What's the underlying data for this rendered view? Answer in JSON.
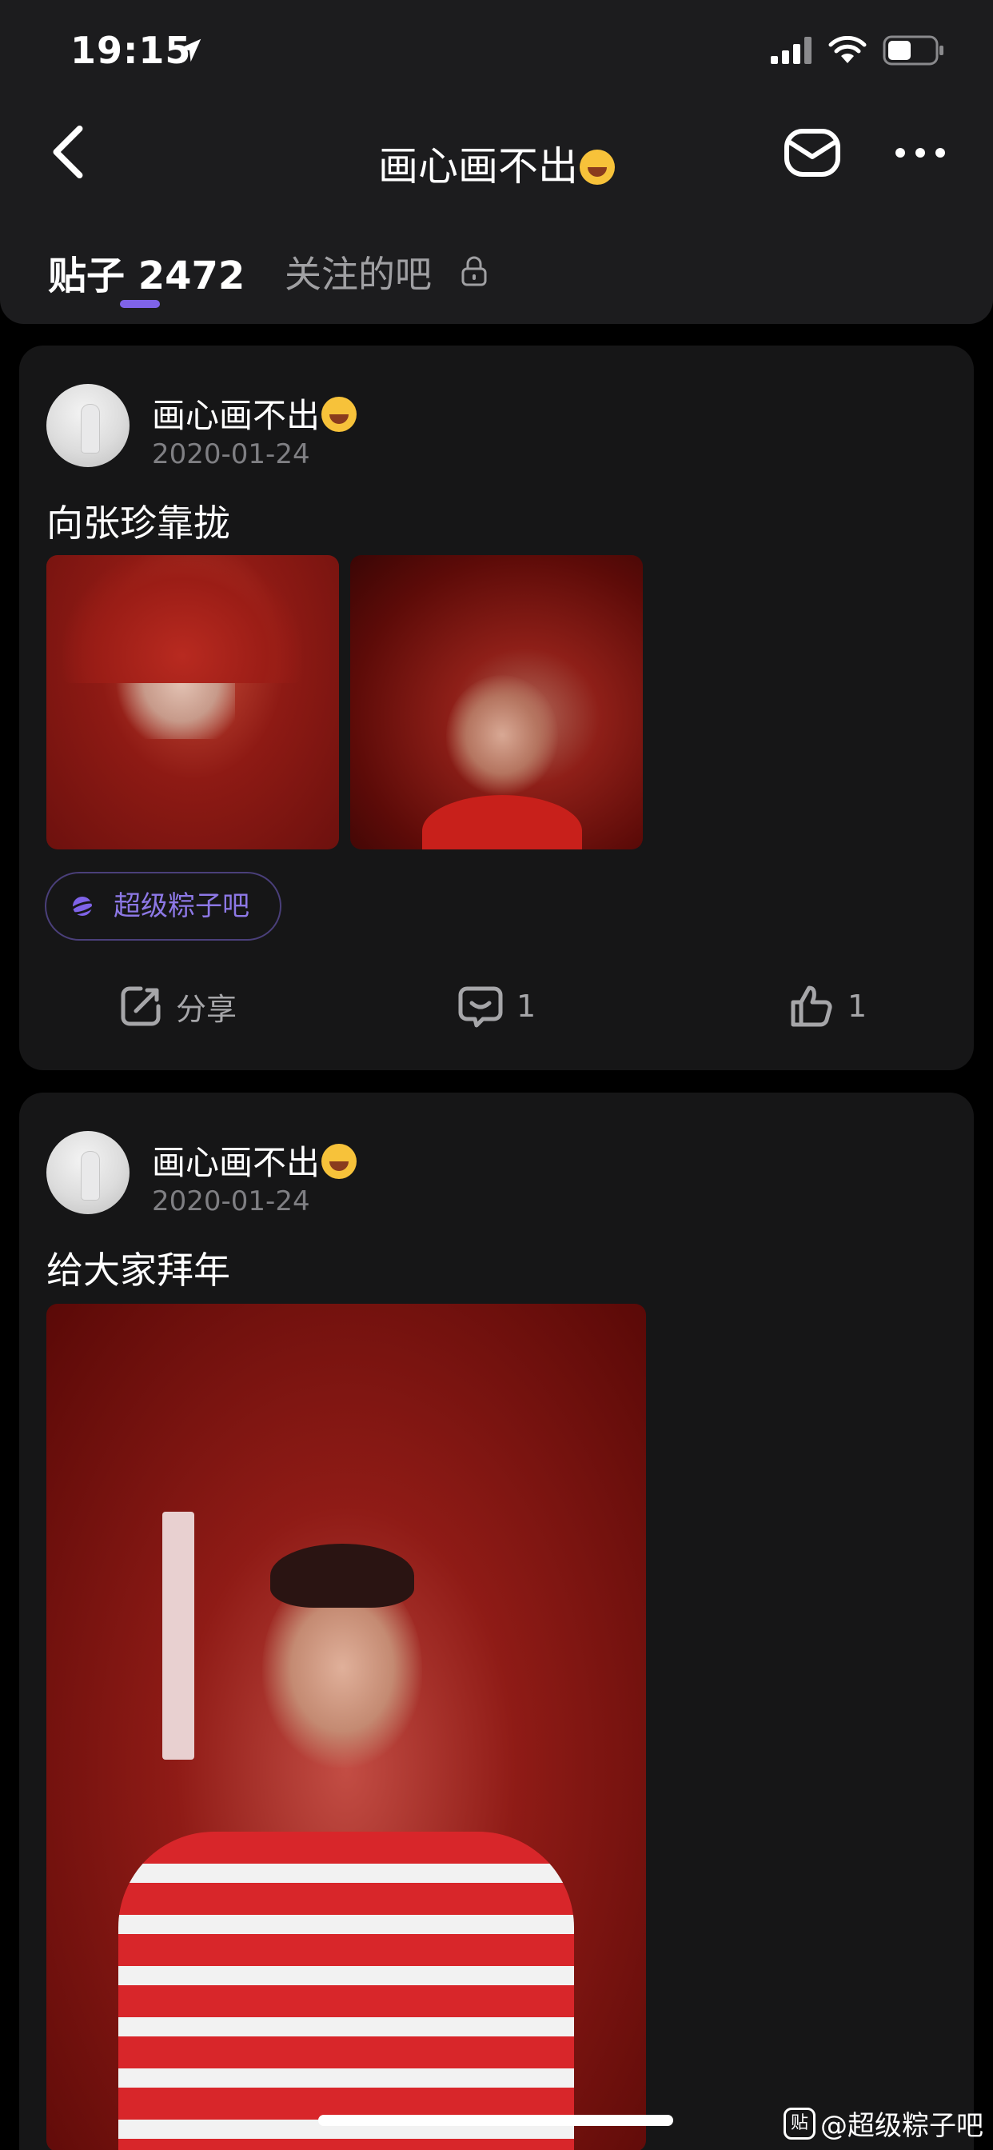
{
  "status_bar": {
    "time": "19:15"
  },
  "nav": {
    "title": "画心画不出"
  },
  "tabs": {
    "posts_label": "贴子",
    "posts_count": "2472",
    "followed_label": "关注的吧"
  },
  "posts": [
    {
      "author": "画心画不出",
      "date": "2020-01-24",
      "text": "向张珍靠拢",
      "tag": "超级粽子吧",
      "share_label": "分享",
      "comments": "1",
      "likes": "1"
    },
    {
      "author": "画心画不出",
      "date": "2020-01-24",
      "text": "给大家拜年"
    }
  ],
  "watermark": {
    "icon_text": "贴",
    "text": "@超级粽子吧"
  },
  "colors": {
    "accent": "#7f63e8",
    "background": "#000000",
    "card": "#161617",
    "tag_text": "#8d78e6"
  },
  "icons": [
    "location-arrow-icon",
    "signal-icon",
    "wifi-icon",
    "battery-icon",
    "back-chevron-icon",
    "mail-icon",
    "more-icon",
    "lock-icon",
    "planet-icon",
    "share-icon",
    "comment-icon",
    "like-icon"
  ]
}
